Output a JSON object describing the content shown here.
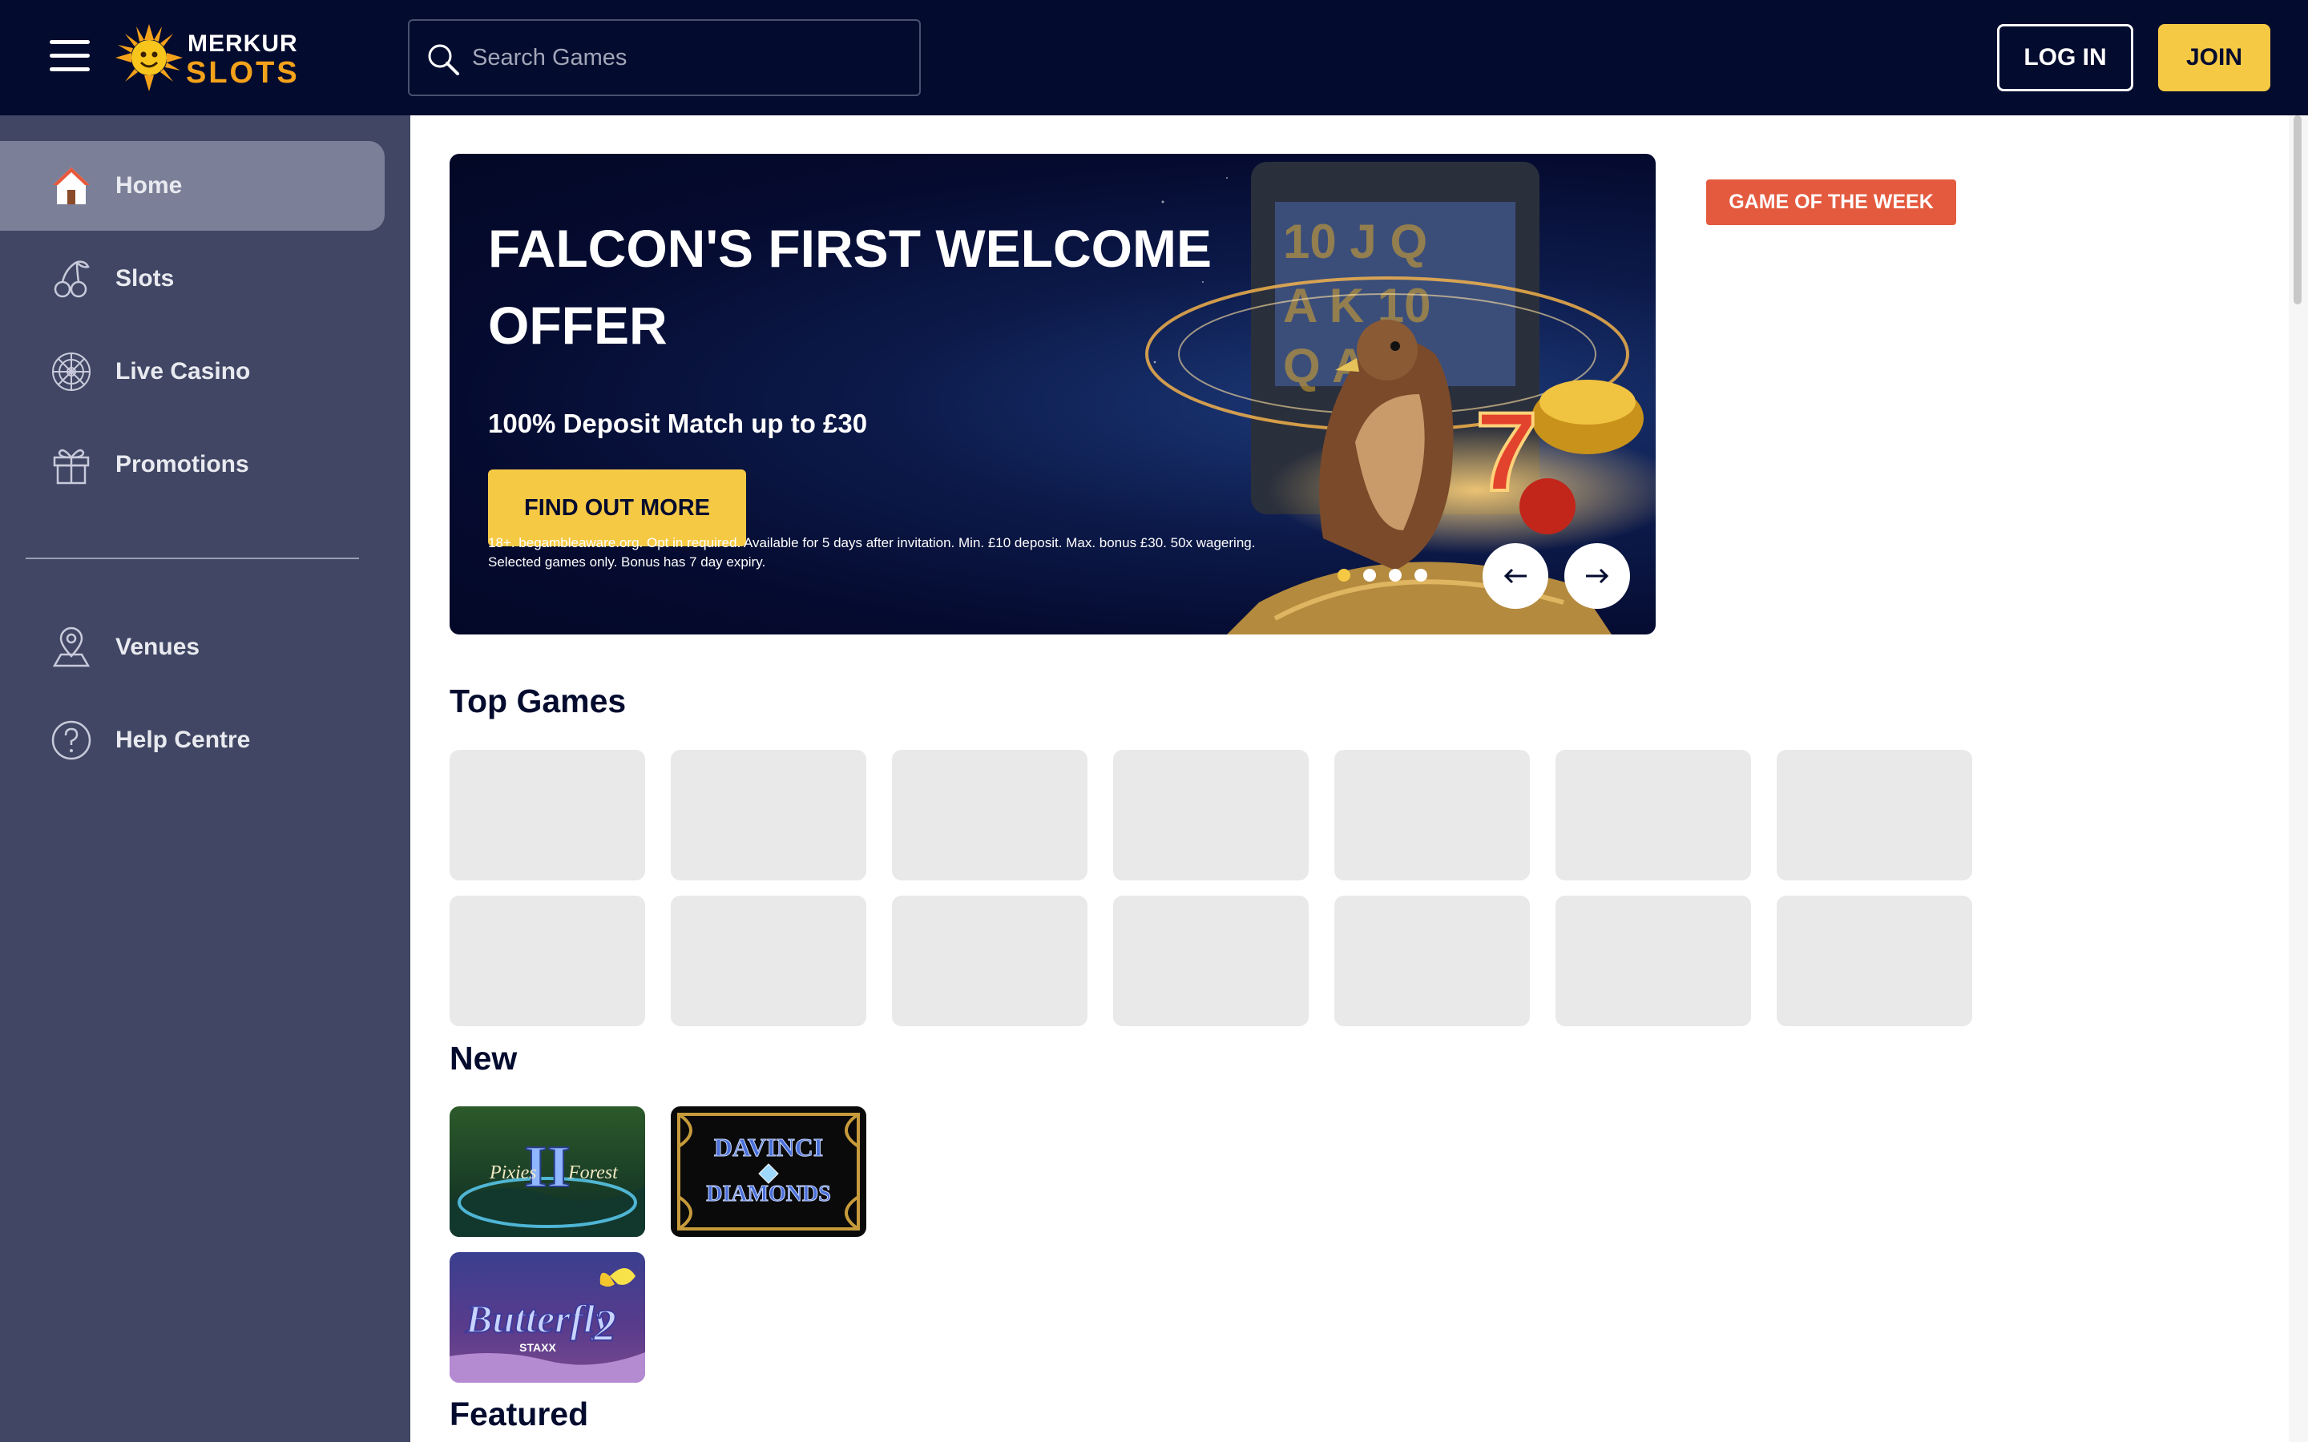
{
  "header": {
    "logo": {
      "line1": "MERKUR",
      "line2": "SLOTS"
    },
    "search": {
      "placeholder": "Search Games",
      "value": ""
    },
    "login_label": "LOG IN",
    "join_label": "JOIN"
  },
  "sidebar": {
    "items": [
      {
        "label": "Home",
        "icon": "home-icon",
        "active": true
      },
      {
        "label": "Slots",
        "icon": "cherries-icon",
        "active": false
      },
      {
        "label": "Live Casino",
        "icon": "roulette-wheel-icon",
        "active": false
      },
      {
        "label": "Promotions",
        "icon": "gift-icon",
        "active": false
      }
    ],
    "secondary_items": [
      {
        "label": "Venues",
        "icon": "map-pin-icon"
      },
      {
        "label": "Help Centre",
        "icon": "question-circle-icon"
      }
    ]
  },
  "banner": {
    "title": "FALCON'S FIRST WELCOME OFFER",
    "subtitle": "100% Deposit Match up to £30",
    "cta_label": "FIND OUT MORE",
    "terms": "18+. begambleaware.org. Opt in required. Available for 5 days after invitation. Min. £10 deposit. Max. bonus £30. 50x wagering. Selected games only. Bonus has 7 day expiry.",
    "slide_count": 4,
    "active_slide": 1
  },
  "game_of_the_week_label": "GAME OF THE WEEK",
  "sections": {
    "top_games": {
      "title": "Top Games",
      "placeholder_count": 14
    },
    "new": {
      "title": "New",
      "games": [
        {
          "name": "Pixies of the Forest II",
          "art_text": "Pixies",
          "art_text2": "Forest"
        },
        {
          "name": "Da Vinci Diamonds",
          "art_text": "DAVINCI",
          "art_text2": "DIAMONDS"
        },
        {
          "name": "Butterfly Staxx 2",
          "art_text": "Butterfly",
          "art_text2": "STAXX"
        }
      ]
    },
    "featured": {
      "title": "Featured"
    }
  },
  "colors": {
    "header_bg": "#030b2e",
    "sidebar_bg": "#404663",
    "sidebar_active": "#7b8098",
    "accent_yellow": "#f6c945",
    "badge_red": "#e45a3f",
    "placeholder_tile": "#e9e9e9"
  }
}
